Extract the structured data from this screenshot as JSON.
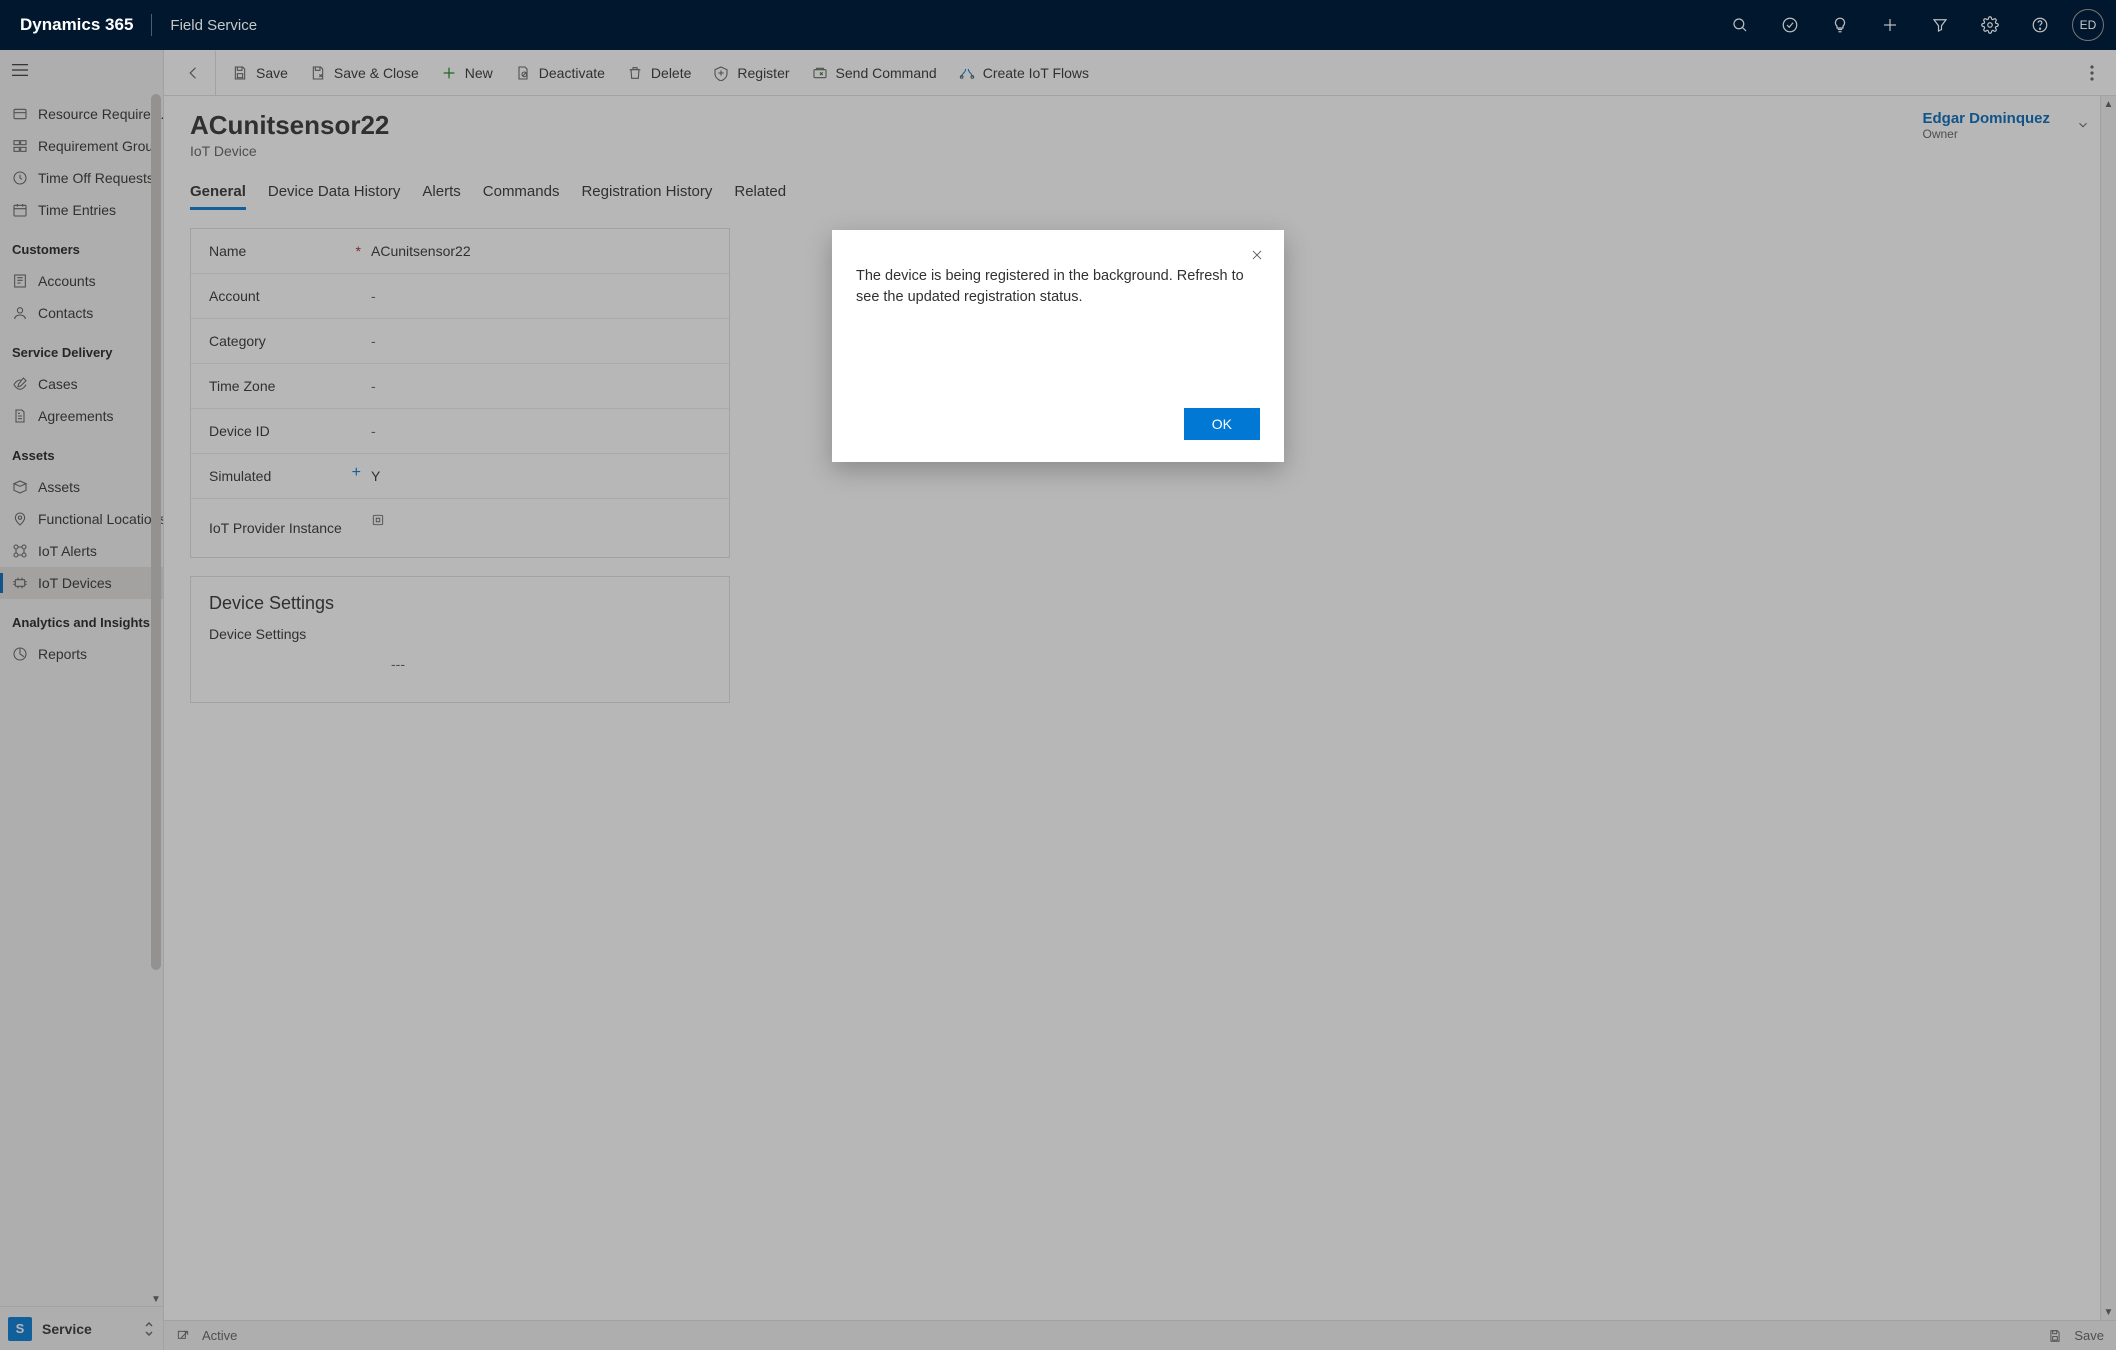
{
  "topbar": {
    "brand": "Dynamics 365",
    "app": "Field Service",
    "avatar_initials": "ED"
  },
  "sidebar": {
    "items_top": [
      {
        "label": "Resource Require…",
        "icon": "resource"
      },
      {
        "label": "Requirement Grou…",
        "icon": "group"
      },
      {
        "label": "Time Off Requests",
        "icon": "timeoff"
      },
      {
        "label": "Time Entries",
        "icon": "calendar"
      }
    ],
    "groups": [
      {
        "title": "Customers",
        "items": [
          {
            "label": "Accounts",
            "icon": "account"
          },
          {
            "label": "Contacts",
            "icon": "contact"
          }
        ]
      },
      {
        "title": "Service Delivery",
        "items": [
          {
            "label": "Cases",
            "icon": "case"
          },
          {
            "label": "Agreements",
            "icon": "doc"
          }
        ]
      },
      {
        "title": "Assets",
        "items": [
          {
            "label": "Assets",
            "icon": "asset"
          },
          {
            "label": "Functional Locations",
            "icon": "location"
          },
          {
            "label": "IoT Alerts",
            "icon": "alert"
          },
          {
            "label": "IoT Devices",
            "icon": "device",
            "active": true
          }
        ]
      },
      {
        "title": "Analytics and Insights",
        "items": [
          {
            "label": "Reports",
            "icon": "report"
          }
        ]
      }
    ],
    "footer": {
      "badge": "S",
      "label": "Service"
    }
  },
  "commands": [
    {
      "label": "Save",
      "icon": "save"
    },
    {
      "label": "Save & Close",
      "icon": "saveclose"
    },
    {
      "label": "New",
      "icon": "new",
      "green": true
    },
    {
      "label": "Deactivate",
      "icon": "deactivate"
    },
    {
      "label": "Delete",
      "icon": "delete"
    },
    {
      "label": "Register",
      "icon": "register"
    },
    {
      "label": "Send Command",
      "icon": "send"
    },
    {
      "label": "Create IoT Flows",
      "icon": "flow"
    }
  ],
  "record": {
    "title": "ACunitsensor22",
    "subtitle": "IoT Device",
    "owner": {
      "name": "Edgar Dominquez",
      "label": "Owner"
    }
  },
  "tabs": [
    "General",
    "Device Data History",
    "Alerts",
    "Commands",
    "Registration History",
    "Related"
  ],
  "active_tab": "General",
  "form": [
    {
      "label": "Name",
      "value": "ACunitsensor22",
      "required": true
    },
    {
      "label": "Account",
      "value": "-"
    },
    {
      "label": "Category",
      "value": "-"
    },
    {
      "label": "Time Zone",
      "value": "-"
    },
    {
      "label": "Device ID",
      "value": "-"
    },
    {
      "label": "Simulated",
      "value": "Y",
      "recommended": true
    },
    {
      "label": "IoT Provider Instance",
      "value": "",
      "lookup": true
    }
  ],
  "section": {
    "title": "Device Settings",
    "sub": "Device Settings",
    "value": "---"
  },
  "statusbar": {
    "status": "Active",
    "save": "Save"
  },
  "modal": {
    "message": "The device is being registered in the background. Refresh to see the updated registration status.",
    "ok": "OK"
  }
}
